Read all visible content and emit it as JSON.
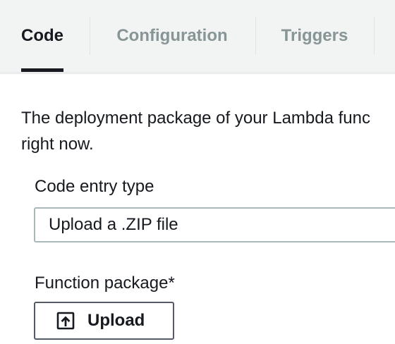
{
  "tabs": [
    {
      "label": "Code",
      "active": true
    },
    {
      "label": "Configuration",
      "active": false
    },
    {
      "label": "Triggers",
      "active": false
    }
  ],
  "code_panel": {
    "description_line1": "The deployment package of your Lambda func",
    "description_line2": "right now.",
    "code_entry_type": {
      "label": "Code entry type",
      "value": "Upload a .ZIP file"
    },
    "function_package": {
      "label": "Function package*",
      "button_label": "Upload",
      "button_icon": "upload-icon"
    }
  },
  "colors": {
    "tab_bar_bg": "#f2f3f3",
    "active_tab_text": "#16191f",
    "inactive_tab_text": "#879596",
    "active_tab_indicator": "#16191f"
  }
}
